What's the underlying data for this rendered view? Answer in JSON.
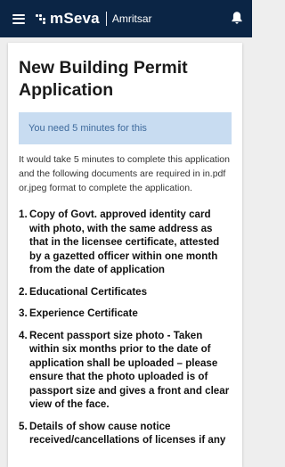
{
  "header": {
    "menu_icon": "hamburger-menu-icon",
    "logo_text": "mSeva",
    "city": "Amritsar",
    "bell_icon": "notification-bell-icon",
    "background": "#0b2545"
  },
  "page": {
    "title": "New Building Permit Application",
    "time_note": "You need 5 minutes for this",
    "description": "It would take 5 minutes to complete this application and the following documents are required in in.pdf or.jpeg format to complete the application.",
    "documents": [
      {
        "num": "1.",
        "text": "Copy of Govt. approved identity card with photo, with the same address as that in the licensee certificate, attested by a gazetted officer within one month from the date of application"
      },
      {
        "num": "2.",
        "text": "Educational Certificates"
      },
      {
        "num": "3.",
        "text": "Experience Certificate"
      },
      {
        "num": "4.",
        "text": "Recent passport size photo - Taken within six months prior to the date of application shall be uploaded – please ensure that the photo uploaded is of passport size and gives a front and clear view of the face."
      },
      {
        "num": "5.",
        "text": "Details of show cause notice received/cancellations of licenses if any"
      }
    ]
  }
}
